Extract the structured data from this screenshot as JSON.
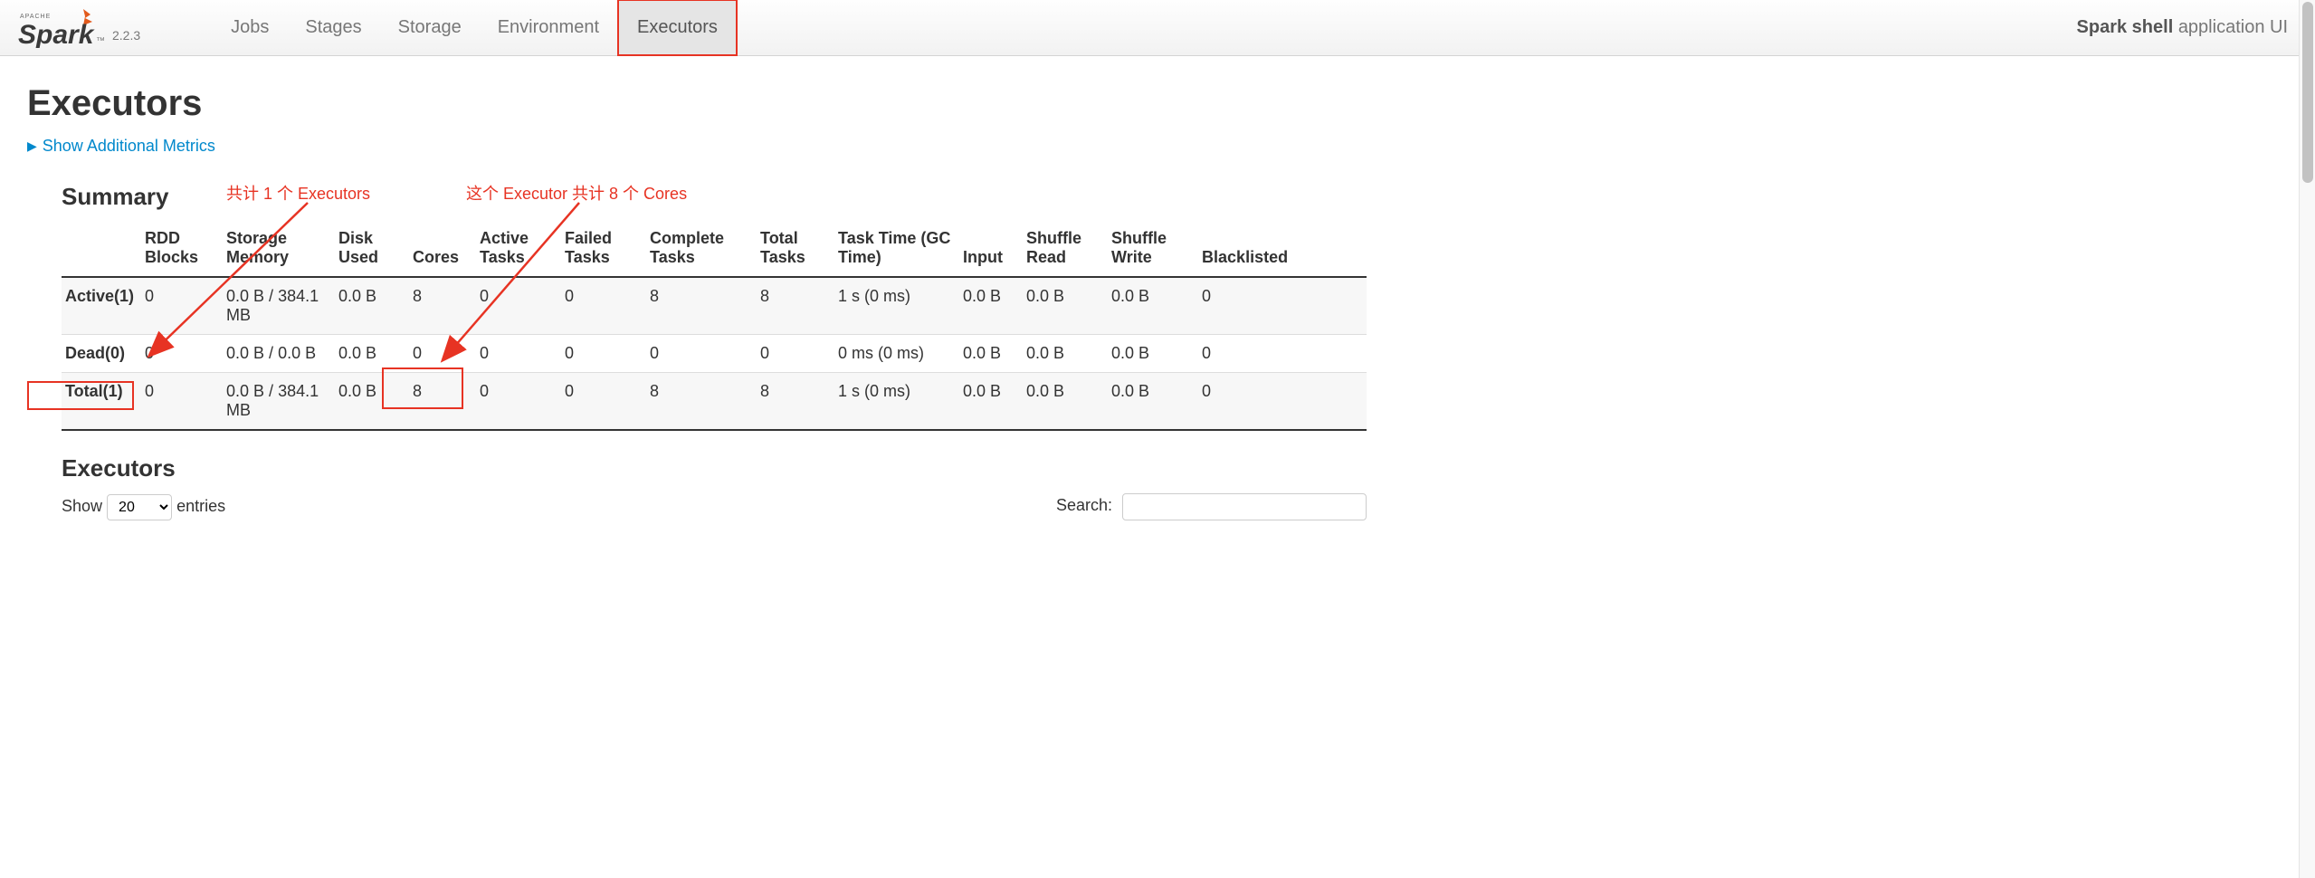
{
  "brand": {
    "version": "2.2.3"
  },
  "nav": {
    "jobs": "Jobs",
    "stages": "Stages",
    "storage": "Storage",
    "environment": "Environment",
    "executors": "Executors"
  },
  "app_title": {
    "name": "Spark shell",
    "suffix": "application UI"
  },
  "page": {
    "title": "Executors",
    "show_additional": "Show Additional Metrics",
    "summary_heading": "Summary",
    "executors_heading": "Executors"
  },
  "annotations": {
    "a1": "共计 1 个 Executors",
    "a2": "这个 Executor 共计 8 个 Cores"
  },
  "summary_headers": {
    "status": "",
    "rdd_blocks": "RDD Blocks",
    "storage_memory": "Storage Memory",
    "disk_used": "Disk Used",
    "cores": "Cores",
    "active_tasks": "Active Tasks",
    "failed_tasks": "Failed Tasks",
    "complete_tasks": "Complete Tasks",
    "total_tasks": "Total Tasks",
    "task_time": "Task Time (GC Time)",
    "input": "Input",
    "shuffle_read": "Shuffle Read",
    "shuffle_write": "Shuffle Write",
    "blacklisted": "Blacklisted"
  },
  "summary_rows": [
    {
      "label": "Active(1)",
      "rdd": "0",
      "mem": "0.0 B / 384.1 MB",
      "disk": "0.0 B",
      "cores": "8",
      "active": "0",
      "failed": "0",
      "complete": "8",
      "total": "8",
      "tasktime": "1 s (0 ms)",
      "input": "0.0 B",
      "sread": "0.0 B",
      "swrite": "0.0 B",
      "black": "0"
    },
    {
      "label": "Dead(0)",
      "rdd": "0",
      "mem": "0.0 B / 0.0 B",
      "disk": "0.0 B",
      "cores": "0",
      "active": "0",
      "failed": "0",
      "complete": "0",
      "total": "0",
      "tasktime": "0 ms (0 ms)",
      "input": "0.0 B",
      "sread": "0.0 B",
      "swrite": "0.0 B",
      "black": "0"
    },
    {
      "label": "Total(1)",
      "rdd": "0",
      "mem": "0.0 B / 384.1 MB",
      "disk": "0.0 B",
      "cores": "8",
      "active": "0",
      "failed": "0",
      "complete": "8",
      "total": "8",
      "tasktime": "1 s (0 ms)",
      "input": "0.0 B",
      "sread": "0.0 B",
      "swrite": "0.0 B",
      "black": "0"
    }
  ],
  "controls": {
    "show_label_pre": "Show",
    "show_value": "20",
    "show_label_post": "entries",
    "search_label": "Search:"
  }
}
